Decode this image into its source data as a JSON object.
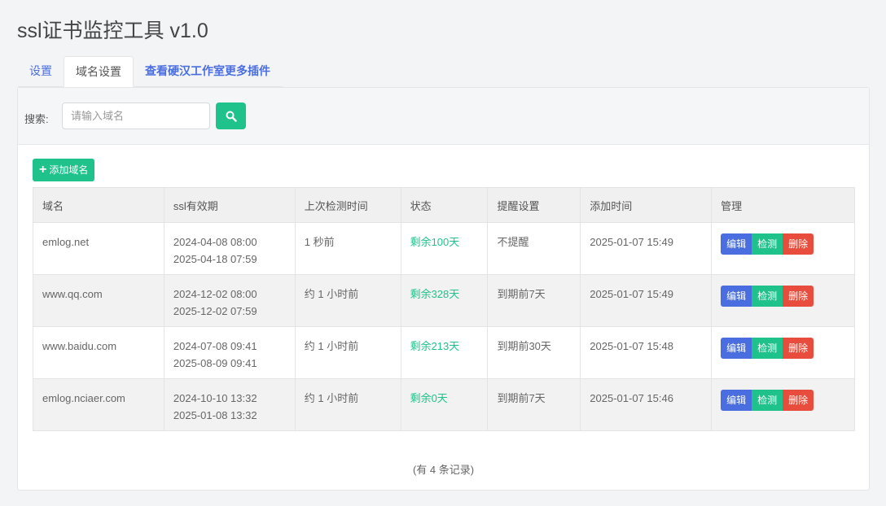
{
  "app": {
    "title": "ssl证书监控工具 v1.0"
  },
  "tabs": [
    {
      "label": "设置",
      "active": false
    },
    {
      "label": "域名设置",
      "active": true
    },
    {
      "label": "查看硬汉工作室更多插件",
      "active": false
    }
  ],
  "search": {
    "label": "搜索:",
    "placeholder": "请输入域名",
    "value": "",
    "icon": "search-icon"
  },
  "toolbar": {
    "add_label": "添加域名",
    "add_icon": "plus-icon"
  },
  "table": {
    "columns": [
      "域名",
      "ssl有效期",
      "上次检测时间",
      "状态",
      "提醒设置",
      "添加时间",
      "管理"
    ],
    "rows": [
      {
        "domain": "emlog.net",
        "valid_from": "2024-04-08 08:00",
        "valid_to": "2025-04-18 07:59",
        "last_check": "1 秒前",
        "status": "剩余100天",
        "reminder": "不提醒",
        "added": "2025-01-07 15:49"
      },
      {
        "domain": "www.qq.com",
        "valid_from": "2024-12-02 08:00",
        "valid_to": "2025-12-02 07:59",
        "last_check": "约 1 小时前",
        "status": "剩余328天",
        "reminder": "到期前7天",
        "added": "2025-01-07 15:49"
      },
      {
        "domain": "www.baidu.com",
        "valid_from": "2024-07-08 09:41",
        "valid_to": "2025-08-09 09:41",
        "last_check": "约 1 小时前",
        "status": "剩余213天",
        "reminder": "到期前30天",
        "added": "2025-01-07 15:48"
      },
      {
        "domain": "emlog.nciaer.com",
        "valid_from": "2024-10-10 13:32",
        "valid_to": "2025-01-08 13:32",
        "last_check": "约 1 小时前",
        "status": "剩余0天",
        "reminder": "到期前7天",
        "added": "2025-01-07 15:46"
      }
    ],
    "actions": {
      "edit": "编辑",
      "check": "检测",
      "delete": "删除"
    }
  },
  "footer": {
    "count_text": "(有 4 条记录)"
  },
  "colors": {
    "primary": "#4a6ee0",
    "success": "#1fc28b",
    "danger": "#e74c3c"
  }
}
